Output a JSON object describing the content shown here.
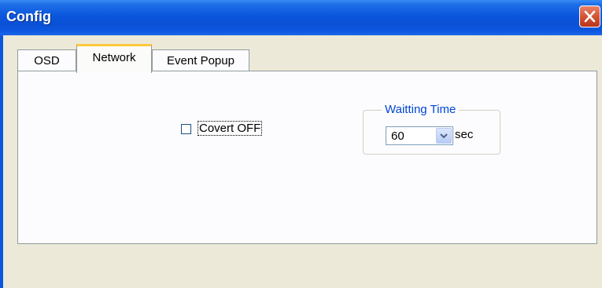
{
  "window": {
    "title": "Config"
  },
  "tabs": [
    {
      "label": "OSD",
      "active": false
    },
    {
      "label": "Network",
      "active": true
    },
    {
      "label": "Event Popup",
      "active": false
    }
  ],
  "network": {
    "covert_checkbox": {
      "label": "Covert OFF",
      "checked": false
    },
    "waiting_time": {
      "group_label": "Waitting Time",
      "selected_value": "60",
      "unit": "sec"
    }
  },
  "icons": {
    "close": "close-icon",
    "dropdown": "chevron-down-icon"
  },
  "colors": {
    "titlebar": "#0a56dd",
    "group_label": "#0046d5",
    "active_tab_highlight": "#ffc83c",
    "close_button": "#d2502f"
  }
}
